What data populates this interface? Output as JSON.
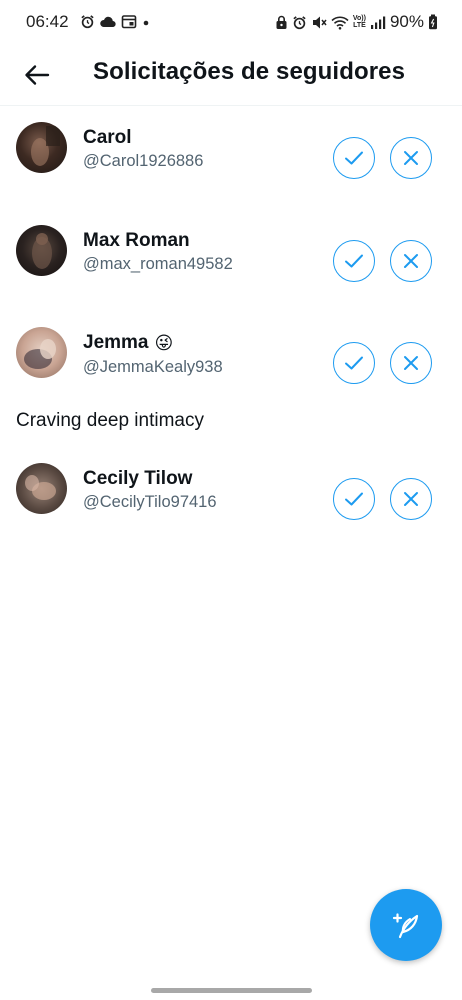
{
  "status_bar": {
    "time": "06:42",
    "left_icons": [
      "alarm-icon",
      "cloud-icon",
      "calendar-icon",
      "dot-icon"
    ],
    "right_icons": [
      "lock-icon",
      "alarm-icon",
      "mute-icon",
      "wifi-icon",
      "volte-icon",
      "signal-icon"
    ],
    "volte_top": "Vo))",
    "volte_bottom": "LTE",
    "battery": "90%"
  },
  "header": {
    "title": "Solicitações de seguidores"
  },
  "requests": [
    {
      "name": "Carol",
      "handle": "@Carol1926886",
      "emoji": "",
      "bio": ""
    },
    {
      "name": "Max Roman",
      "handle": "@max_roman49582",
      "emoji": "",
      "bio": ""
    },
    {
      "name": "Jemma",
      "handle": "@JemmaKealy938",
      "emoji": "😜",
      "bio": "Craving deep intimacy"
    },
    {
      "name": "Cecily Tilow",
      "handle": "@CecilyTilo97416",
      "emoji": "",
      "bio": ""
    }
  ],
  "colors": {
    "accent": "#1d9bf0",
    "text_primary": "#0f1419",
    "text_secondary": "#536471"
  },
  "fab": {
    "icon": "compose-feather-icon"
  }
}
